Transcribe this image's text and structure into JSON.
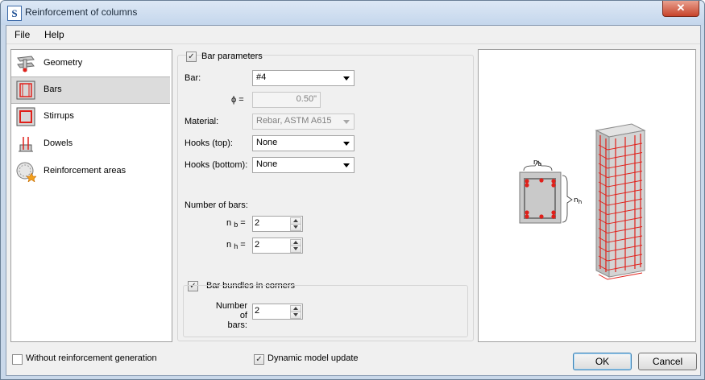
{
  "window": {
    "title": "Reinforcement of columns",
    "app_icon": "S",
    "close_glyph": "✕"
  },
  "menu": {
    "file": "File",
    "help": "Help"
  },
  "nav": {
    "items": [
      {
        "label": "Geometry",
        "icon": "geometry-icon"
      },
      {
        "label": "Bars",
        "icon": "bars-icon",
        "selected": true
      },
      {
        "label": "Stirrups",
        "icon": "stirrups-icon"
      },
      {
        "label": "Dowels",
        "icon": "dowels-icon"
      },
      {
        "label": "Reinforcement areas",
        "icon": "reinforcement-areas-icon"
      }
    ]
  },
  "params": {
    "group_label": "Bar parameters",
    "group_checked": true,
    "bar_label": "Bar:",
    "bar_value": "#4",
    "phi_label": "ϕ =",
    "phi_value": "0.50\"",
    "material_label": "Material:",
    "material_value": "Rebar,  ASTM A615",
    "hooks_top_label": "Hooks (top):",
    "hooks_top_value": "None",
    "hooks_bottom_label": "Hooks (bottom):",
    "hooks_bottom_value": "None",
    "number_of_bars_label": "Number of bars:",
    "nb_symbol": "n",
    "nb_sub": "b",
    "nb_eq": "=",
    "nb_value": "2",
    "nh_symbol": "n",
    "nh_sub": "h",
    "nh_eq": "=",
    "nh_value": "2"
  },
  "bundles": {
    "label": "Bar bundles in corners",
    "checked": true,
    "number_label_line1": "Number of",
    "number_label_line2": "bars:",
    "value": "2"
  },
  "preview": {
    "nb_label": "n",
    "nb_sub": "b",
    "nh_label": "n",
    "nh_sub": "h",
    "rebar_color": "#e0201a"
  },
  "footer": {
    "without_generation": "Without reinforcement generation",
    "without_generation_checked": false,
    "dynamic_update": "Dynamic model update",
    "dynamic_update_checked": true,
    "ok": "OK",
    "cancel": "Cancel"
  }
}
